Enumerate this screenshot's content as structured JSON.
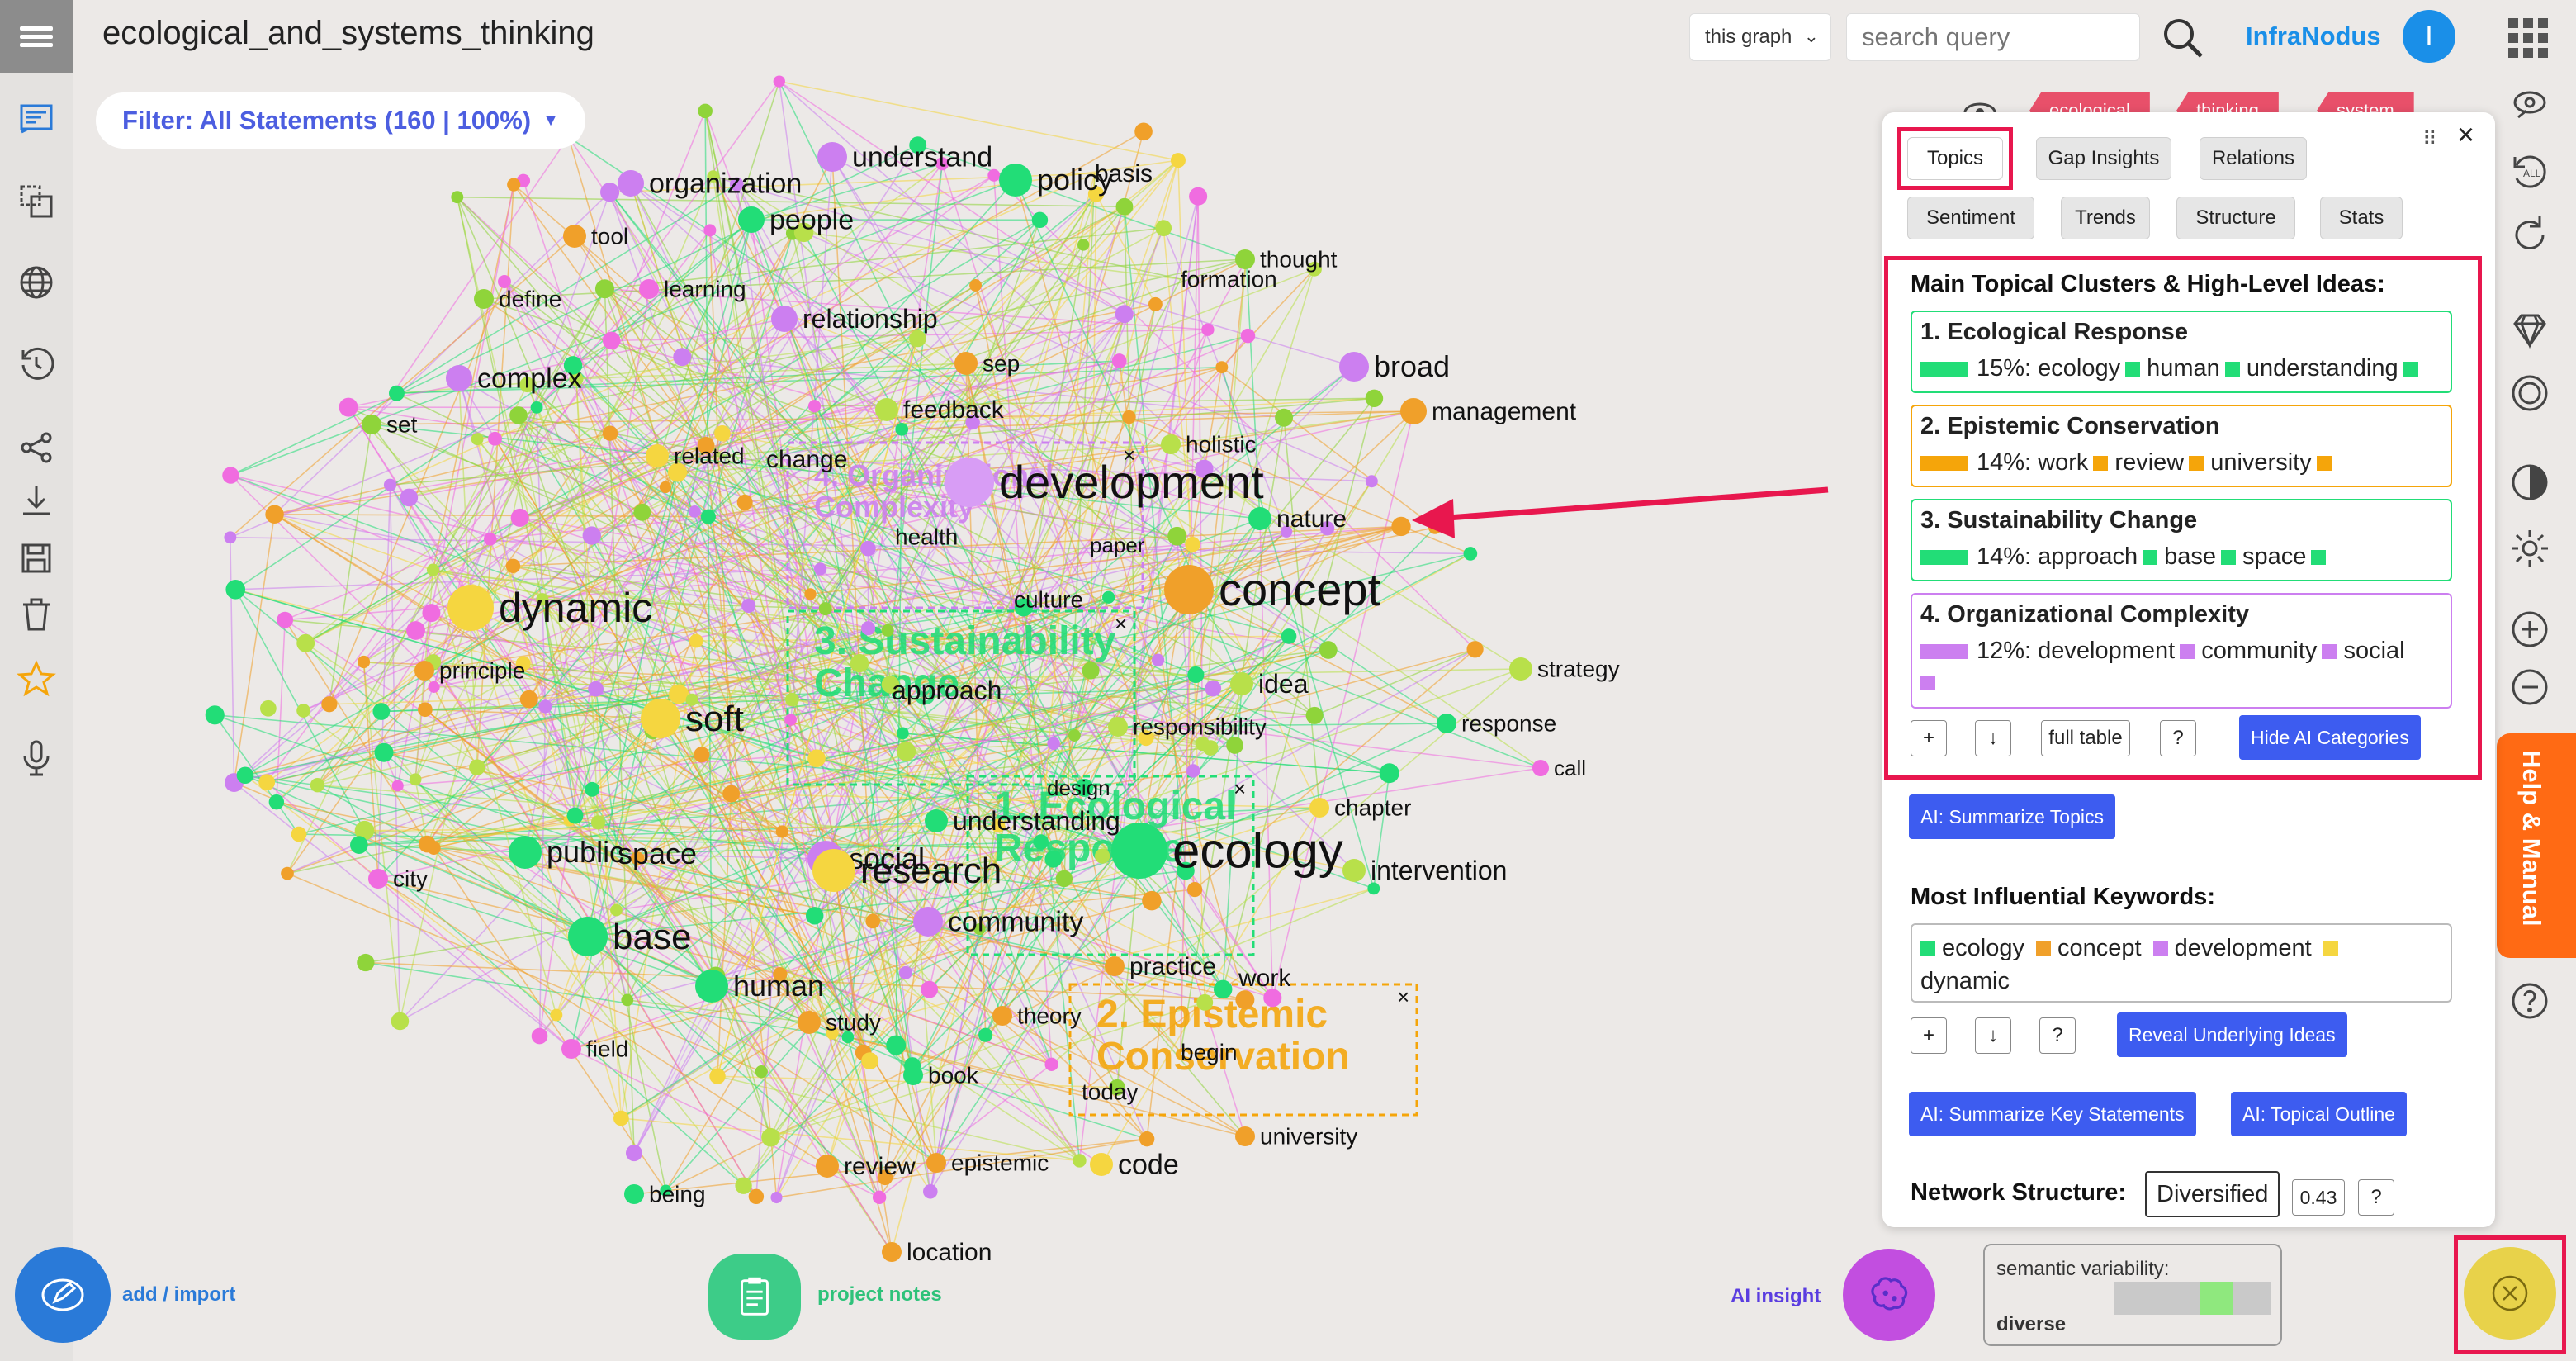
{
  "app": {
    "graph_title": "ecological_and_systems_thinking",
    "filter_label": "Filter: All Statements (160 | 100%)",
    "brand": "InfraNodus",
    "user_initial": "I",
    "scope_select": "this graph",
    "search_placeholder": "search query"
  },
  "tags": [
    "ecological",
    "thinking",
    "system"
  ],
  "graph": {
    "cluster_overlays": [
      {
        "label": "4. Organizational Complexity",
        "color": "#cc7ff0"
      },
      {
        "label": "3. Sustainability Change",
        "color": "#22dd77"
      },
      {
        "label": "1. Ecological Response",
        "color": "#22dd77"
      },
      {
        "label": "2. Epistemic Conservation",
        "color": "#f5a50a"
      }
    ],
    "nodes": [
      {
        "label": "development",
        "color": "#d89df5"
      },
      {
        "label": "concept",
        "color": "#f0a02a"
      },
      {
        "label": "ecology",
        "color": "#22dd77"
      },
      {
        "label": "dynamic",
        "color": "#f5d640"
      },
      {
        "label": "soft",
        "color": "#f5d640"
      },
      {
        "label": "public",
        "color": "#22dd77"
      },
      {
        "label": "space",
        "color": "#22dd77"
      },
      {
        "label": "social",
        "color": "#cc7ff0"
      },
      {
        "label": "research",
        "color": "#f5d640"
      },
      {
        "label": "base",
        "color": "#22dd77"
      },
      {
        "label": "human",
        "color": "#22dd77"
      },
      {
        "label": "understand",
        "color": "#cc7ff0"
      },
      {
        "label": "organization",
        "color": "#cc7ff0"
      },
      {
        "label": "policy",
        "color": "#22dd77"
      },
      {
        "label": "basis",
        "color": "#f5d640"
      },
      {
        "label": "people",
        "color": "#22dd77"
      },
      {
        "label": "tool",
        "color": "#f0a02a"
      },
      {
        "label": "thought",
        "color": "#8fd43a"
      },
      {
        "label": "formation",
        "color": "#8fd43a"
      },
      {
        "label": "define",
        "color": "#8fd43a"
      },
      {
        "label": "learning",
        "color": "#f06ce0"
      },
      {
        "label": "relationship",
        "color": "#cc7ff0"
      },
      {
        "label": "sep",
        "color": "#f0a02a"
      },
      {
        "label": "broad",
        "color": "#cc7ff0"
      },
      {
        "label": "complex",
        "color": "#cc7ff0"
      },
      {
        "label": "feedback",
        "color": "#b8e04a"
      },
      {
        "label": "management",
        "color": "#f0a02a"
      },
      {
        "label": "set",
        "color": "#8fd43a"
      },
      {
        "label": "related",
        "color": "#f5d640"
      },
      {
        "label": "change",
        "color": "#22dd77"
      },
      {
        "label": "holistic",
        "color": "#b8e04a"
      },
      {
        "label": "nature",
        "color": "#22dd77"
      },
      {
        "label": "health",
        "color": "#cc7ff0"
      },
      {
        "label": "paper",
        "color": "#f0a02a"
      },
      {
        "label": "culture",
        "color": "#cc7ff0"
      },
      {
        "label": "principle",
        "color": "#f0a02a"
      },
      {
        "label": "approach",
        "color": "#22dd77"
      },
      {
        "label": "idea",
        "color": "#b8e04a"
      },
      {
        "label": "responsibility",
        "color": "#b8e04a"
      },
      {
        "label": "strategy",
        "color": "#b8e04a"
      },
      {
        "label": "response",
        "color": "#22dd77"
      },
      {
        "label": "call",
        "color": "#f06ce0"
      },
      {
        "label": "design",
        "color": "#f5d640"
      },
      {
        "label": "understanding",
        "color": "#22dd77"
      },
      {
        "label": "chapter",
        "color": "#f5d640"
      },
      {
        "label": "city",
        "color": "#f06ce0"
      },
      {
        "label": "intervention",
        "color": "#b8e04a"
      },
      {
        "label": "community",
        "color": "#cc7ff0"
      },
      {
        "label": "practice",
        "color": "#f0a02a"
      },
      {
        "label": "work",
        "color": "#f0a02a"
      },
      {
        "label": "study",
        "color": "#f0a02a"
      },
      {
        "label": "theory",
        "color": "#f0a02a"
      },
      {
        "label": "begin",
        "color": "#f0a02a"
      },
      {
        "label": "field",
        "color": "#f06ce0"
      },
      {
        "label": "book",
        "color": "#22dd77"
      },
      {
        "label": "today",
        "color": "#f0a02a"
      },
      {
        "label": "university",
        "color": "#f0a02a"
      },
      {
        "label": "review",
        "color": "#f0a02a"
      },
      {
        "label": "epistemic",
        "color": "#f0a02a"
      },
      {
        "label": "code",
        "color": "#f5d640"
      },
      {
        "label": "being",
        "color": "#22dd77"
      },
      {
        "label": "location",
        "color": "#f0a02a"
      }
    ]
  },
  "panel": {
    "tabs_row1": [
      "Topics",
      "Gap Insights",
      "Relations"
    ],
    "tabs_row2": [
      "Sentiment",
      "Trends",
      "Structure",
      "Stats"
    ],
    "clusters_title": "Main Topical Clusters & High-Level Ideas:",
    "clusters": [
      {
        "title": "1. Ecological Response",
        "percent": "15%:",
        "keywords": [
          "ecology",
          "human",
          "understanding"
        ],
        "color": "#22dd77"
      },
      {
        "title": "2. Epistemic Conservation",
        "percent": "14%:",
        "keywords": [
          "work",
          "review",
          "university"
        ],
        "color": "#f5a50a"
      },
      {
        "title": "3. Sustainability Change",
        "percent": "14%:",
        "keywords": [
          "approach",
          "base",
          "space"
        ],
        "color": "#22dd77"
      },
      {
        "title": "4. Organizational Complexity",
        "percent": "12%:",
        "keywords": [
          "development",
          "community",
          "social"
        ],
        "color": "#cc7ff0"
      }
    ],
    "cluster_buttons": {
      "plus": "+",
      "download": "↓",
      "full_table": "full table",
      "help": "?",
      "hide": "Hide AI Categories"
    },
    "summarize_topics": "AI: Summarize Topics",
    "keywords_title": "Most Influential Keywords:",
    "keywords": [
      {
        "word": "ecology",
        "color": "#22dd77"
      },
      {
        "word": "concept",
        "color": "#f0a02a"
      },
      {
        "word": "development",
        "color": "#cc7ff0"
      },
      {
        "word": "dynamic",
        "color": "#f5d640"
      }
    ],
    "keyword_buttons": {
      "plus": "+",
      "download": "↓",
      "help": "?",
      "reveal": "Reveal Underlying Ideas"
    },
    "summarize_statements": "AI: Summarize Key Statements",
    "topical_outline": "AI: Topical Outline",
    "network_structure_label": "Network Structure:",
    "network_structure_value": "Diversified",
    "modularity": "0.43",
    "network_help": "?"
  },
  "bottom": {
    "add_import": "add / import",
    "project_notes": "project notes",
    "ai_insight": "AI insight",
    "semantic_variability": "semantic variability:",
    "semantic_value": "diverse",
    "semantic_level": 0.6
  },
  "help_tab": "Help & Manual",
  "colors": {
    "accent": "#4c5ee0",
    "brand": "#1a8fe8",
    "highlight": "#e8174e",
    "help": "#ff6a14"
  }
}
